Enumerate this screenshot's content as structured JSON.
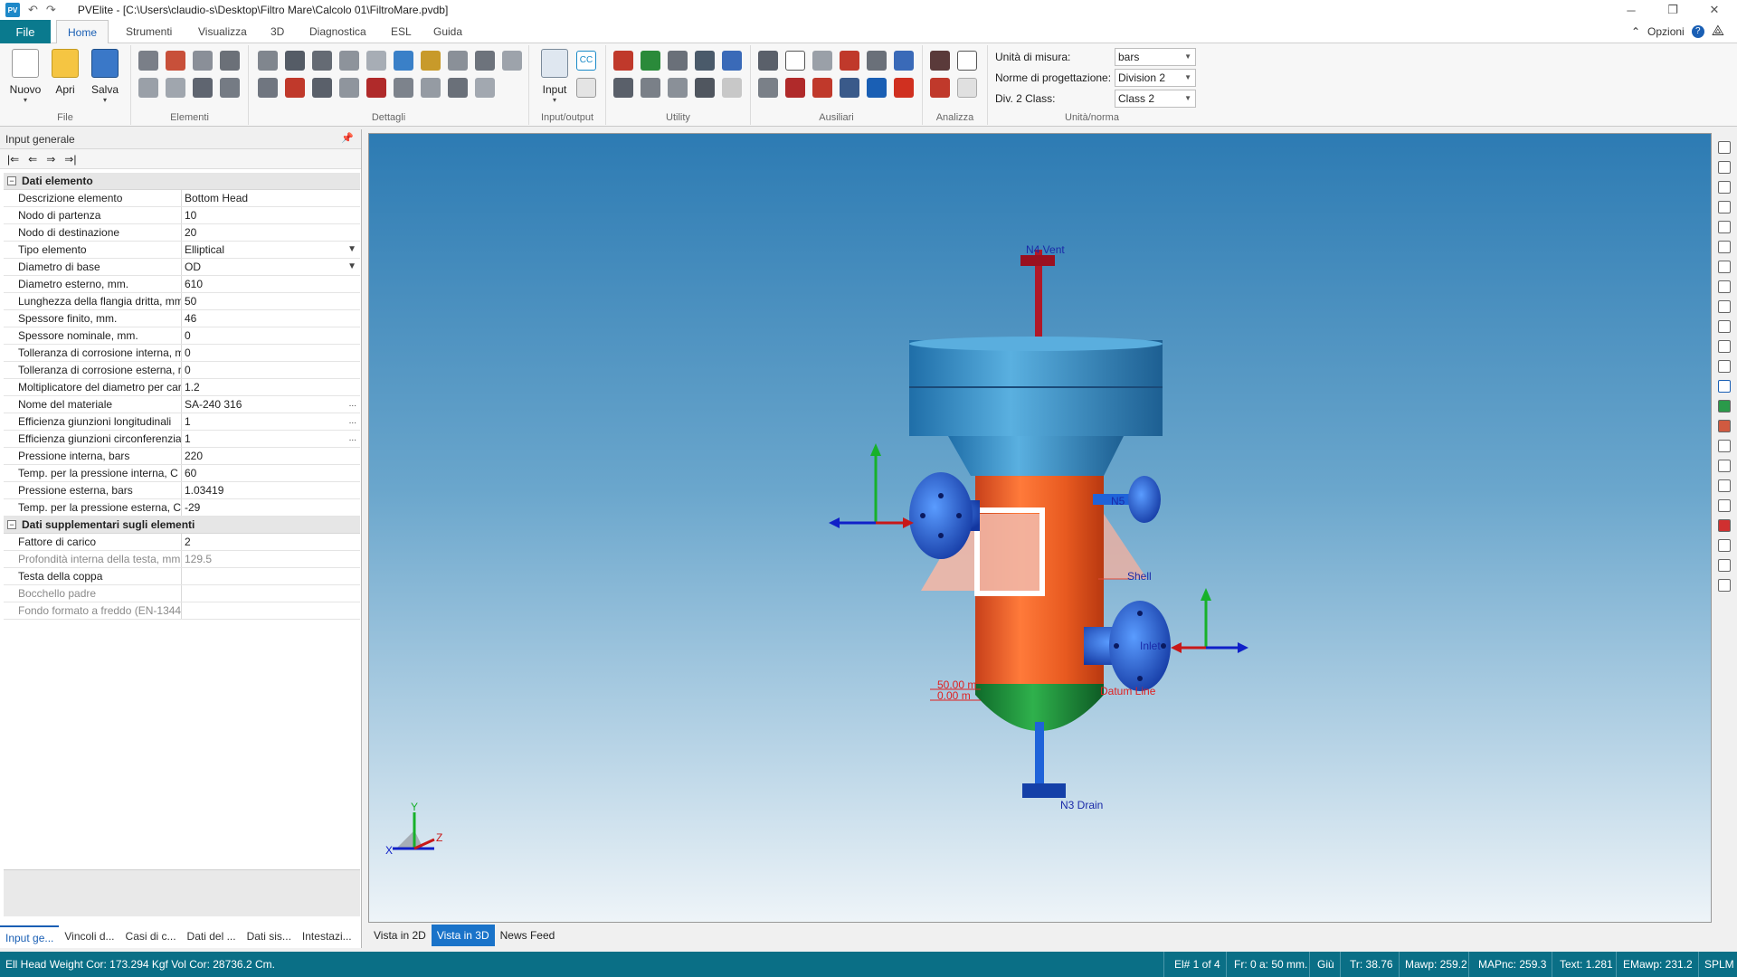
{
  "window": {
    "app_icon": "PV",
    "title": "PVElite - [C:\\Users\\claudio-s\\Desktop\\Filtro Mare\\Calcolo 01\\FiltroMare.pvdb]"
  },
  "ribbon_tabs": {
    "file": "File",
    "items": [
      "Home",
      "Strumenti",
      "Visualizza",
      "3D",
      "Diagnostica",
      "ESL",
      "Guida"
    ],
    "options": "Opzioni"
  },
  "ribbon": {
    "file_group": {
      "label": "File",
      "new": "Nuovo",
      "open": "Apri",
      "save": "Salva"
    },
    "elements_group": "Elementi",
    "details_group": "Dettagli",
    "io_group": {
      "label": "Input/output",
      "input": "Input"
    },
    "utility_group": "Utility",
    "aux_group": "Ausiliari",
    "analyze_group": "Analizza",
    "units_group": {
      "label": "Unità/norma",
      "units_label": "Unità di misura:",
      "units_value": "bars",
      "code_label": "Norme di progettazione:",
      "code_value": "Division 2",
      "class_label": "Div. 2 Class:",
      "class_value": "Class 2"
    }
  },
  "left_panel": {
    "title": "Input generale",
    "nav_icons": [
      "first-icon",
      "prev-icon",
      "next-icon",
      "last-icon"
    ],
    "section1": "Dati elemento",
    "rows1": [
      {
        "label": "Descrizione elemento",
        "value": "Bottom Head"
      },
      {
        "label": "Nodo di partenza",
        "value": "10"
      },
      {
        "label": "Nodo di destinazione",
        "value": "20"
      },
      {
        "label": "Tipo elemento",
        "value": "Elliptical"
      },
      {
        "label": "Diametro di base",
        "value": "OD"
      },
      {
        "label": "Diametro esterno, mm.",
        "value": "610"
      },
      {
        "label": "Lunghezza della flangia dritta, mm",
        "value": "50"
      },
      {
        "label": "Spessore finito, mm.",
        "value": "46"
      },
      {
        "label": "Spessore nominale, mm.",
        "value": "0"
      },
      {
        "label": "Tolleranza di corrosione interna, mm",
        "value": "0"
      },
      {
        "label": "Tolleranza di corrosione esterna, mm",
        "value": "0"
      },
      {
        "label": "Moltiplicatore del diametro per carico",
        "value": "1.2"
      },
      {
        "label": "Nome del materiale",
        "value": "SA-240 316"
      },
      {
        "label": "Efficienza giunzioni longitudinali",
        "value": "1"
      },
      {
        "label": "Efficienza giunzioni circonferenziali",
        "value": "1"
      },
      {
        "label": "Pressione interna, bars",
        "value": "220"
      },
      {
        "label": "Temp. per la pressione interna, C",
        "value": "60"
      },
      {
        "label": "Pressione esterna, bars",
        "value": "1.03419"
      },
      {
        "label": "Temp. per la pressione esterna, C",
        "value": "-29"
      }
    ],
    "section2": "Dati supplementari sugli elementi",
    "rows2": [
      {
        "label": "Fattore di carico",
        "value": "2"
      },
      {
        "label": "Profondità interna della testa, mm",
        "value": "129.5"
      },
      {
        "label": "Testa della coppa",
        "value": ""
      },
      {
        "label": "Bocchello padre",
        "value": ""
      },
      {
        "label": "Fondo formato a freddo (EN-13445)",
        "value": ""
      }
    ],
    "bottom_tabs": [
      "Input ge...",
      "Vincoli d...",
      "Casi di c...",
      "Dati del ...",
      "Dati sis...",
      "Intestazi..."
    ]
  },
  "viewport": {
    "labels": {
      "vent": "N4 Vent",
      "drain": "N3 Drain",
      "shell": "Shell",
      "inlet": "Inlet",
      "n5": "N5",
      "datum": "Datum Line",
      "elev1": "50.00 m",
      "elev2": "0.00 m"
    },
    "axes": {
      "x": "X",
      "y": "Y",
      "z": "Z"
    },
    "colors": {
      "shell": "#ff6a2a",
      "head_top": "#3b93c8",
      "bottom_head": "#1a8a3a",
      "nozzle": "#1f63d9",
      "vent": "#b01020",
      "support": "#f4b8a8"
    }
  },
  "view_tabs": [
    "Vista in 2D",
    "Vista in 3D",
    "News Feed"
  ],
  "status": {
    "left": "Ell Head Weight Cor: 173.294 Kgf  Vol Cor: 28736.2 Cm.",
    "el": "El# 1 of 4",
    "fr": "Fr: 0 a: 50 mm.",
    "giu": "Giù",
    "tr": "Tr: 38.76",
    "mawp": "Mawp: 259.2",
    "mapnc": "MAPnc: 259.3",
    "trext": "Text: 1.281",
    "emawp": "EMawp: 231.2",
    "splm": "SPLM"
  }
}
